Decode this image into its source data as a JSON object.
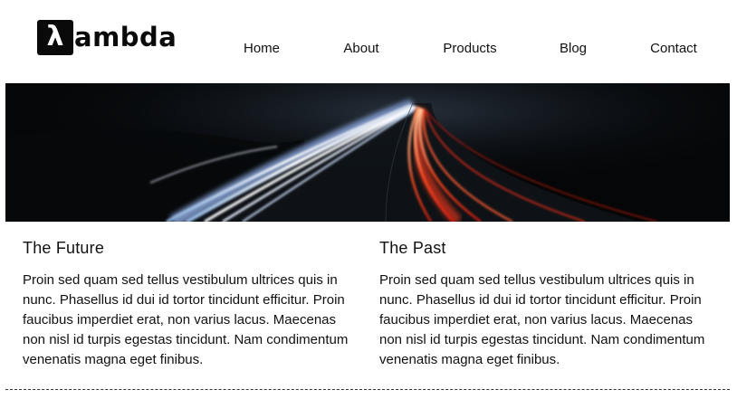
{
  "brand": {
    "logo_symbol": "λ",
    "logo_text": "ambda"
  },
  "nav": {
    "home": "Home",
    "about": "About",
    "products": "Products",
    "blog": "Blog",
    "contact": "Contact"
  },
  "hero": {
    "image": "night highway light trails"
  },
  "sections": [
    {
      "title": "The Future",
      "body": "Proin sed quam sed tellus vestibulum ultrices quis in nunc. Phasellus id dui id tortor tincidunt efficitur. Proin faucibus imperdiet erat, non varius lacus. Maecenas non nisl id turpis egestas tincidunt. Nam condimentum venenatis magna eget finibus."
    },
    {
      "title": "The Past",
      "body": "Proin sed quam sed tellus vestibulum ultrices quis in nunc. Phasellus id dui id tortor tincidunt efficitur. Proin faucibus imperdiet erat, non varius lacus. Maecenas non nisl id turpis egestas tincidunt. Nam condimentum venenatis magna eget finibus."
    }
  ],
  "colors": {
    "text": "#111111",
    "background": "#ffffff",
    "hero_dark": "#050607",
    "trail_red": "#ff3a1a",
    "trail_white": "#e8f0ff"
  }
}
